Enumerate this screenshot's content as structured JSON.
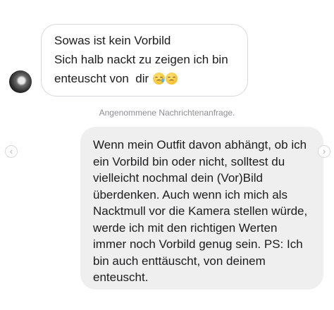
{
  "incoming_message": {
    "lines": [
      "Sowas ist kein Vorbild",
      "Sich halb nackt zu zeigen ich bin",
      "enteuscht von  dir"
    ],
    "emojis": [
      "crying-face-icon",
      "pensive-face-icon"
    ]
  },
  "system_note": "Angenommene Nachrichtenanfrage.",
  "outgoing_message": {
    "lines": [
      "Wenn mein Outfit davon abhängt, ob ich",
      "ein Vorbild bin oder nicht, solltest du",
      "vielleicht nochmal dein (Vor)Bild",
      "überdenken. Auch wenn ich mich als",
      "Nacktmull vor die Kamera stellen würde,",
      "werde ich mit den richtigen Werten",
      "immer noch Vorbild genug sein. PS: Ich",
      "bin auch enttäuscht, von deinem",
      "enteuscht."
    ]
  },
  "navigation": {
    "prev_symbol": "‹",
    "next_symbol": "›"
  },
  "colors": {
    "incoming_bubble_border": "#d8d8dc",
    "outgoing_bubble_bg": "#efefef",
    "system_note_text": "#8e8e93"
  }
}
